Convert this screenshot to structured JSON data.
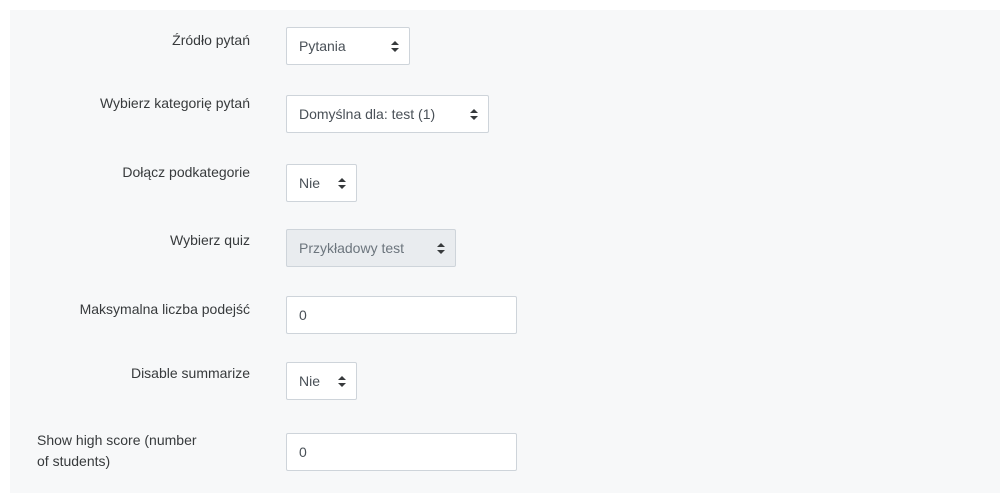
{
  "form": {
    "question_source": {
      "label": "Źródło pytań",
      "value": "Pytania"
    },
    "question_category": {
      "label": "Wybierz kategorię pytań",
      "value": "Domyślna dla: test (1)"
    },
    "include_subcategories": {
      "label": "Dołącz podkategorie",
      "value": "Nie"
    },
    "choose_quiz": {
      "label": "Wybierz quiz",
      "value": "Przykładowy test"
    },
    "max_attempts": {
      "label": "Maksymalna liczba podejść",
      "value": "0"
    },
    "disable_summarize": {
      "label": "Disable summarize",
      "value": "Nie"
    },
    "show_high_score": {
      "label_line1": "Show high score (number",
      "label_line2": "of students)",
      "value": "0"
    }
  },
  "icons": {
    "select_caret": "up-down-caret-icon"
  }
}
